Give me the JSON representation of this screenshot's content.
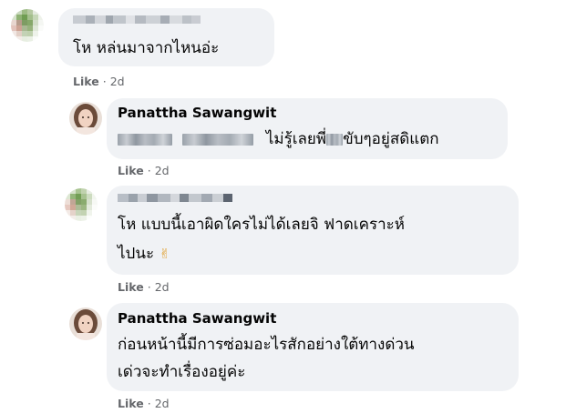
{
  "comments": [
    {
      "author": "",
      "text_lines": [
        "โห หล่นมาจากไหนอ่ะ"
      ],
      "like_label": "Like",
      "time": "2d"
    },
    {
      "author": "Panattha Sawangwit",
      "text_after_blur": "ไม่รู้เลยพี่",
      "text_end": "ขับๆอยู่สดิแตก",
      "like_label": "Like",
      "time": "2d"
    },
    {
      "author": "",
      "text_lines": [
        "โห แบบนี้เอาผิดใครไม่ได้เลยจิ ฟาดเคราะห์",
        "ไปนะ"
      ],
      "emoji": "✌",
      "like_label": "Like",
      "time": "2d"
    },
    {
      "author": "Panattha Sawangwit",
      "text_lines": [
        "ก่อนหน้านี้มีการซ่อมอะไรสักอย่างใต้ทางด่วน",
        "เด่วจะทำเรื่องอยู่ค่ะ"
      ],
      "like_label": "Like",
      "time": "2d"
    }
  ],
  "dot": "·",
  "colors": {
    "bubble": "#f0f2f5",
    "meta": "#65676b",
    "text": "#050505"
  }
}
